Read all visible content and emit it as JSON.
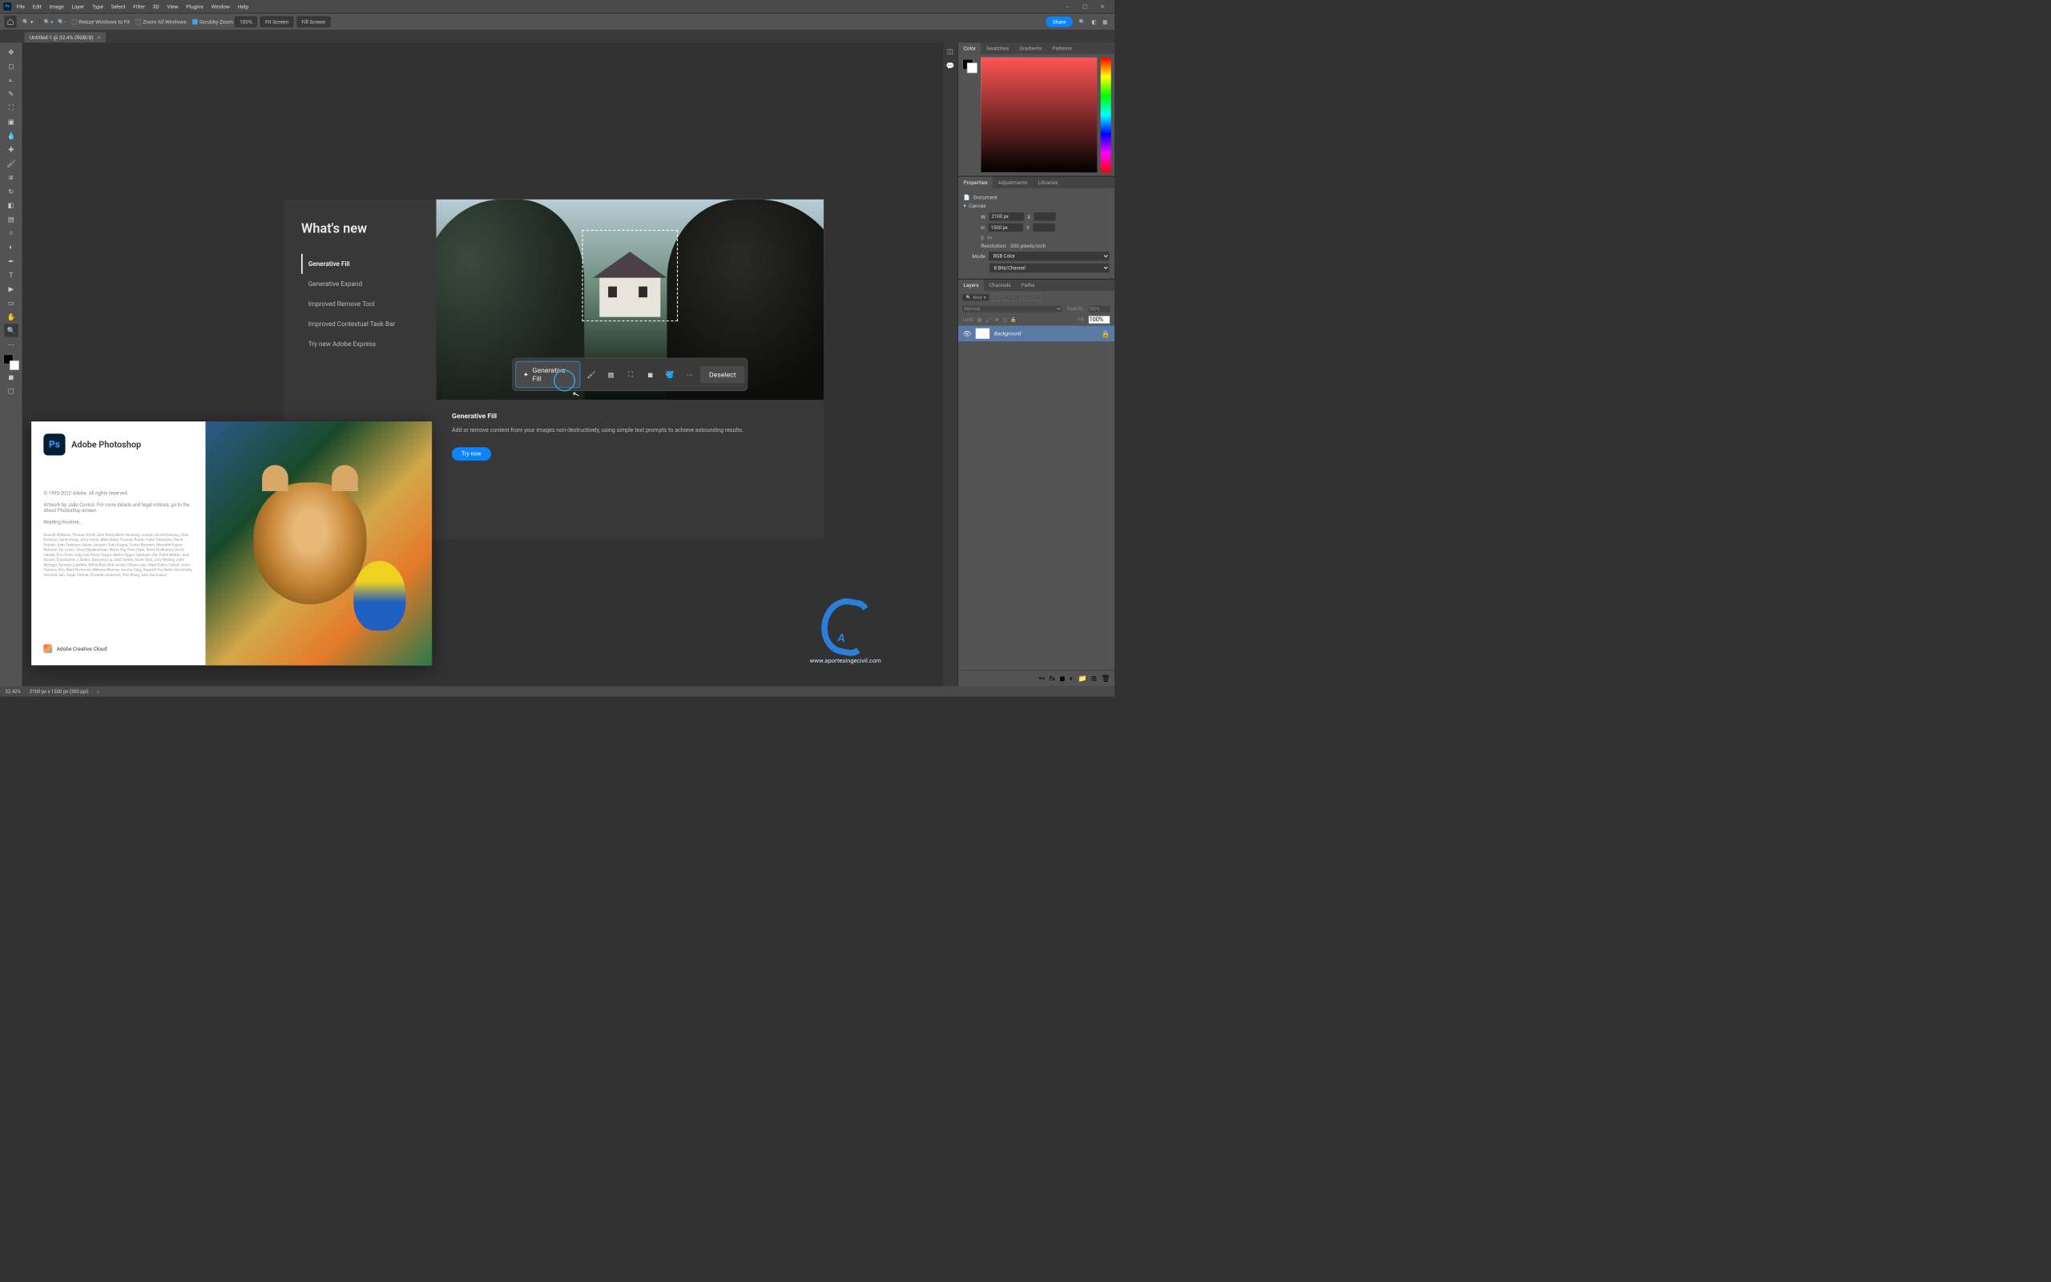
{
  "menubar": [
    "File",
    "Edit",
    "Image",
    "Layer",
    "Type",
    "Select",
    "Filter",
    "3D",
    "View",
    "Plugins",
    "Window",
    "Help"
  ],
  "optbar": {
    "resize_label": "Resize Windows to Fit",
    "zoomall_label": "Zoom All Windows",
    "scrubby_label": "Scrubby Zoom",
    "zoom": "100%",
    "fitscreen": "Fit Screen",
    "fillscreen": "Fill Screen",
    "share": "Share"
  },
  "doc_tab": "Untitled-1 @ 32.4% (RGB/8)",
  "panel_tabs": {
    "group1": [
      "Color",
      "Swatches",
      "Gradients",
      "Patterns"
    ],
    "group2": [
      "Properties",
      "Adjustments",
      "Libraries"
    ],
    "group3": [
      "Layers",
      "Channels",
      "Paths"
    ]
  },
  "properties": {
    "doc": "Document",
    "canvas": "Canvas",
    "w_label": "W",
    "w": "2100 px",
    "h_label": "H",
    "h": "1500 px",
    "x_label": "X",
    "y_label": "Y",
    "res_label": "Resolution:",
    "res": "300 pixels/inch",
    "mode_label": "Mode",
    "mode": "RGB Color",
    "depth": "8 Bits/Channel"
  },
  "layers": {
    "kind": "Kind",
    "blend": "Normal",
    "opacity_label": "Opacity:",
    "opacity": "100%",
    "lock_label": "Lock:",
    "fill_label": "Fill:",
    "fill": "100%",
    "layername": "Background"
  },
  "status": {
    "zoom": "32.42%",
    "docinfo": "2100 px x 1500 px (300 ppi)"
  },
  "whatsnew": {
    "title": "What's new",
    "items": [
      "Generative Fill",
      "Generative Expand",
      "Improved Remove Tool",
      "Improved Contextual Task Bar",
      "Try new Adobe Express"
    ],
    "gfbtn": "Generative Fill",
    "deselect": "Deselect",
    "heading": "Generative Fill",
    "body": "Add or remove content from your images non-destructively, using simple text prompts to achieve astounding results.",
    "try": "Try now"
  },
  "splash": {
    "app": "Adobe Photoshop",
    "copyright": "© 1990-2023 Adobe. All rights reserved.",
    "artwork": "Artwork by João Cunico. For more details and legal notices, go to the About Photoshop screen.",
    "reading": "Reading brushes...",
    "credits": "Russell Williams, Thomas Knoll, John Knoll, Mark Hamburg, Jackie Lincoln-Owyang, Alan Erickson, Sarah Kong, Jerry Harris, Mike Shaw, Thomas Ruark, Yukie Takahashi, David Dobish, John Peterson, Adam Jerugim, Yuko Kagita, Foster Brereton, Meredith Payne Stotzner, Tai Luxon, Vinod Balakrishnan, Maria Yap, Pam Clark, Steve Guilhamet, David Hackel, Eric Floch, Judy Lee, Kevin Hopps, Barkin Aygun, Subhash Jha, Pulkit Mehta, Jack Sisson, Christopher J. Butler, Xiaoyang Liu, Salil Tambe, Oliver Qian, Cory McIlroy, John Metzger, Soumya Lakshmi, Nithin Ravi, Bob Archer, Chhavi Jain, Mark Dahm, Ashish Joshi, Heewoo Ahn, Mark Nichoson, Melissa Monroe, Aasma Garg, Vasanth Pai, Neha Armishetty, Aanchal Jain, Sagar Pathak, Christian Gutierrez, Yilin Wang, Sam Gannaway",
    "cc": "Adobe Creative Cloud"
  },
  "watermark_url": "www.aportesingecivil.com"
}
